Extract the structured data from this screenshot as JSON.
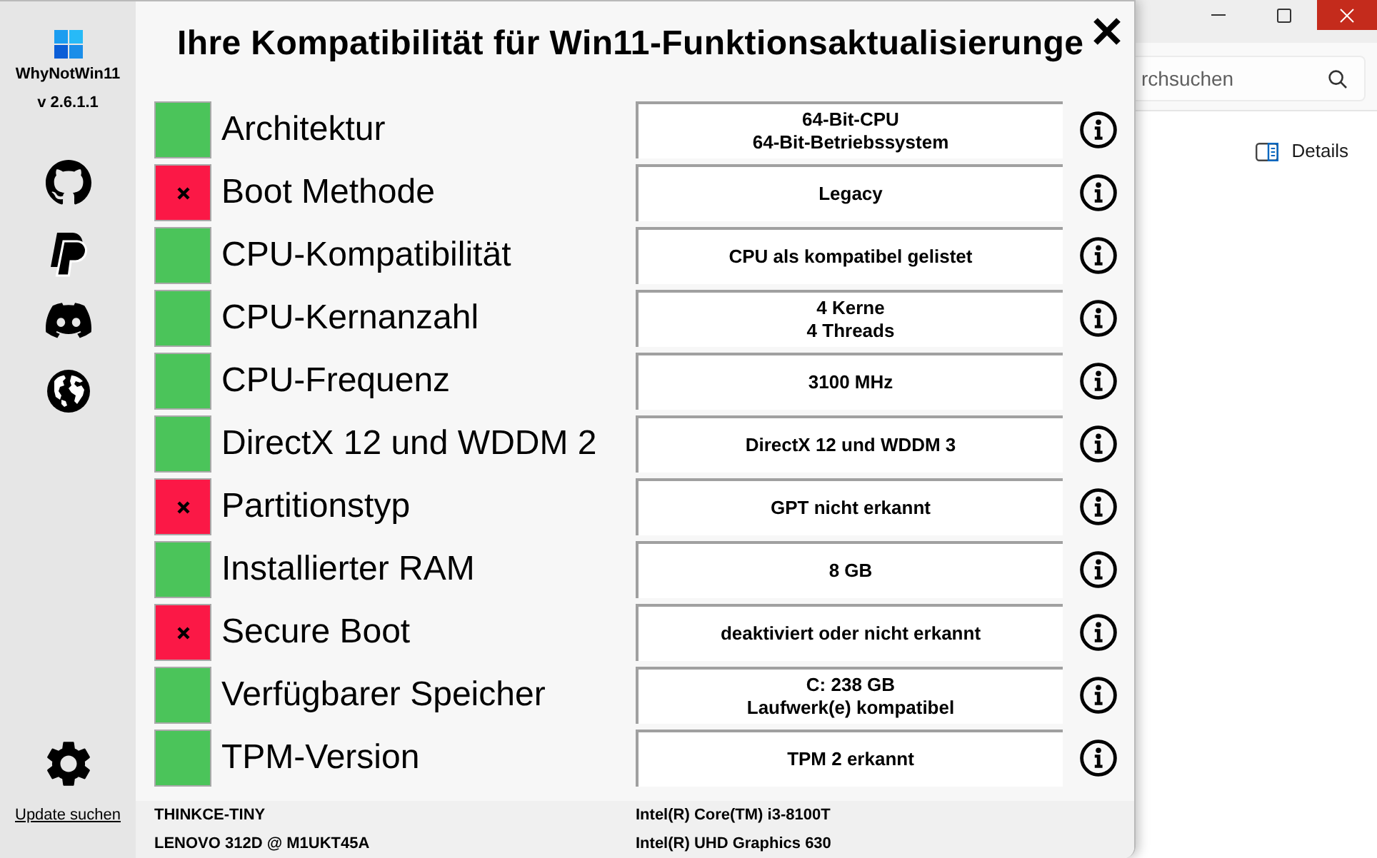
{
  "sidebar": {
    "app_name": "WhyNotWin11",
    "version": "v 2.6.1.1",
    "update_link": "Update suchen"
  },
  "title": "Ihre Kompatibilität für Win11-Funktionsaktualisierunge",
  "checks": [
    {
      "label": "Architektur",
      "passed": true,
      "result": "64-Bit-CPU\n64-Bit-Betriebssystem"
    },
    {
      "label": "Boot Methode",
      "passed": false,
      "result": "Legacy"
    },
    {
      "label": "CPU-Kompatibilität",
      "passed": true,
      "result": "CPU als kompatibel gelistet"
    },
    {
      "label": "CPU-Kernanzahl",
      "passed": true,
      "result": "4 Kerne\n4 Threads"
    },
    {
      "label": "CPU-Frequenz",
      "passed": true,
      "result": "3100 MHz"
    },
    {
      "label": "DirectX 12 und WDDM 2",
      "passed": true,
      "result": "DirectX 12 und WDDM 3"
    },
    {
      "label": "Partitionstyp",
      "passed": false,
      "result": "GPT nicht erkannt"
    },
    {
      "label": "Installierter RAM",
      "passed": true,
      "result": "8 GB"
    },
    {
      "label": "Secure Boot",
      "passed": false,
      "result": "deaktiviert oder nicht erkannt"
    },
    {
      "label": "Verfügbarer Speicher",
      "passed": true,
      "result": "C: 238 GB\nLaufwerk(e) kompatibel"
    },
    {
      "label": "TPM-Version",
      "passed": true,
      "result": "TPM 2 erkannt"
    }
  ],
  "system_info": {
    "computer_name": "THINKCE-TINY",
    "cpu": "Intel(R) Core(TM) i3-8100T",
    "motherboard": "LENOVO 312D @ M1UKT45A",
    "gpu": "Intel(R) UHD Graphics 630"
  },
  "background_window": {
    "search": {
      "placeholder": "rchsuchen"
    },
    "details_button": "Details"
  }
}
